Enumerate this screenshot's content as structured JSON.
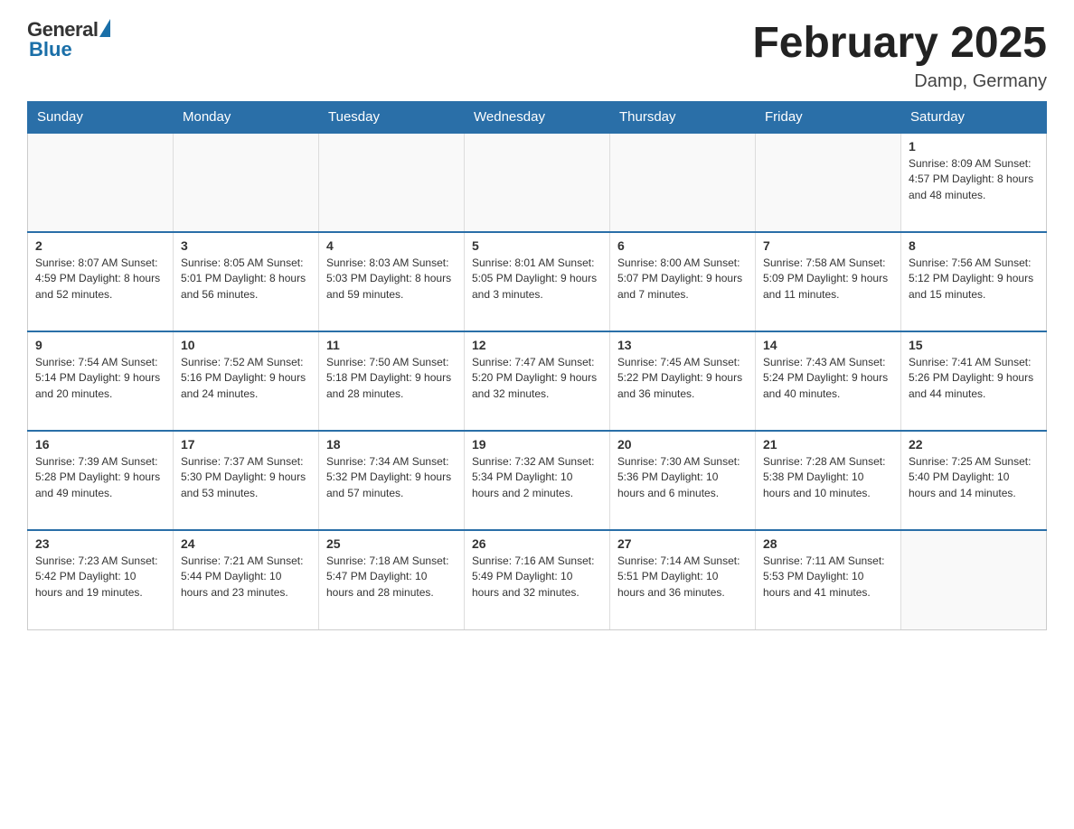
{
  "header": {
    "logo": {
      "general": "General",
      "blue": "Blue"
    },
    "title": "February 2025",
    "subtitle": "Damp, Germany"
  },
  "weekdays": [
    "Sunday",
    "Monday",
    "Tuesday",
    "Wednesday",
    "Thursday",
    "Friday",
    "Saturday"
  ],
  "weeks": [
    [
      {
        "day": "",
        "info": ""
      },
      {
        "day": "",
        "info": ""
      },
      {
        "day": "",
        "info": ""
      },
      {
        "day": "",
        "info": ""
      },
      {
        "day": "",
        "info": ""
      },
      {
        "day": "",
        "info": ""
      },
      {
        "day": "1",
        "info": "Sunrise: 8:09 AM\nSunset: 4:57 PM\nDaylight: 8 hours and 48 minutes."
      }
    ],
    [
      {
        "day": "2",
        "info": "Sunrise: 8:07 AM\nSunset: 4:59 PM\nDaylight: 8 hours and 52 minutes."
      },
      {
        "day": "3",
        "info": "Sunrise: 8:05 AM\nSunset: 5:01 PM\nDaylight: 8 hours and 56 minutes."
      },
      {
        "day": "4",
        "info": "Sunrise: 8:03 AM\nSunset: 5:03 PM\nDaylight: 8 hours and 59 minutes."
      },
      {
        "day": "5",
        "info": "Sunrise: 8:01 AM\nSunset: 5:05 PM\nDaylight: 9 hours and 3 minutes."
      },
      {
        "day": "6",
        "info": "Sunrise: 8:00 AM\nSunset: 5:07 PM\nDaylight: 9 hours and 7 minutes."
      },
      {
        "day": "7",
        "info": "Sunrise: 7:58 AM\nSunset: 5:09 PM\nDaylight: 9 hours and 11 minutes."
      },
      {
        "day": "8",
        "info": "Sunrise: 7:56 AM\nSunset: 5:12 PM\nDaylight: 9 hours and 15 minutes."
      }
    ],
    [
      {
        "day": "9",
        "info": "Sunrise: 7:54 AM\nSunset: 5:14 PM\nDaylight: 9 hours and 20 minutes."
      },
      {
        "day": "10",
        "info": "Sunrise: 7:52 AM\nSunset: 5:16 PM\nDaylight: 9 hours and 24 minutes."
      },
      {
        "day": "11",
        "info": "Sunrise: 7:50 AM\nSunset: 5:18 PM\nDaylight: 9 hours and 28 minutes."
      },
      {
        "day": "12",
        "info": "Sunrise: 7:47 AM\nSunset: 5:20 PM\nDaylight: 9 hours and 32 minutes."
      },
      {
        "day": "13",
        "info": "Sunrise: 7:45 AM\nSunset: 5:22 PM\nDaylight: 9 hours and 36 minutes."
      },
      {
        "day": "14",
        "info": "Sunrise: 7:43 AM\nSunset: 5:24 PM\nDaylight: 9 hours and 40 minutes."
      },
      {
        "day": "15",
        "info": "Sunrise: 7:41 AM\nSunset: 5:26 PM\nDaylight: 9 hours and 44 minutes."
      }
    ],
    [
      {
        "day": "16",
        "info": "Sunrise: 7:39 AM\nSunset: 5:28 PM\nDaylight: 9 hours and 49 minutes."
      },
      {
        "day": "17",
        "info": "Sunrise: 7:37 AM\nSunset: 5:30 PM\nDaylight: 9 hours and 53 minutes."
      },
      {
        "day": "18",
        "info": "Sunrise: 7:34 AM\nSunset: 5:32 PM\nDaylight: 9 hours and 57 minutes."
      },
      {
        "day": "19",
        "info": "Sunrise: 7:32 AM\nSunset: 5:34 PM\nDaylight: 10 hours and 2 minutes."
      },
      {
        "day": "20",
        "info": "Sunrise: 7:30 AM\nSunset: 5:36 PM\nDaylight: 10 hours and 6 minutes."
      },
      {
        "day": "21",
        "info": "Sunrise: 7:28 AM\nSunset: 5:38 PM\nDaylight: 10 hours and 10 minutes."
      },
      {
        "day": "22",
        "info": "Sunrise: 7:25 AM\nSunset: 5:40 PM\nDaylight: 10 hours and 14 minutes."
      }
    ],
    [
      {
        "day": "23",
        "info": "Sunrise: 7:23 AM\nSunset: 5:42 PM\nDaylight: 10 hours and 19 minutes."
      },
      {
        "day": "24",
        "info": "Sunrise: 7:21 AM\nSunset: 5:44 PM\nDaylight: 10 hours and 23 minutes."
      },
      {
        "day": "25",
        "info": "Sunrise: 7:18 AM\nSunset: 5:47 PM\nDaylight: 10 hours and 28 minutes."
      },
      {
        "day": "26",
        "info": "Sunrise: 7:16 AM\nSunset: 5:49 PM\nDaylight: 10 hours and 32 minutes."
      },
      {
        "day": "27",
        "info": "Sunrise: 7:14 AM\nSunset: 5:51 PM\nDaylight: 10 hours and 36 minutes."
      },
      {
        "day": "28",
        "info": "Sunrise: 7:11 AM\nSunset: 5:53 PM\nDaylight: 10 hours and 41 minutes."
      },
      {
        "day": "",
        "info": ""
      }
    ]
  ]
}
